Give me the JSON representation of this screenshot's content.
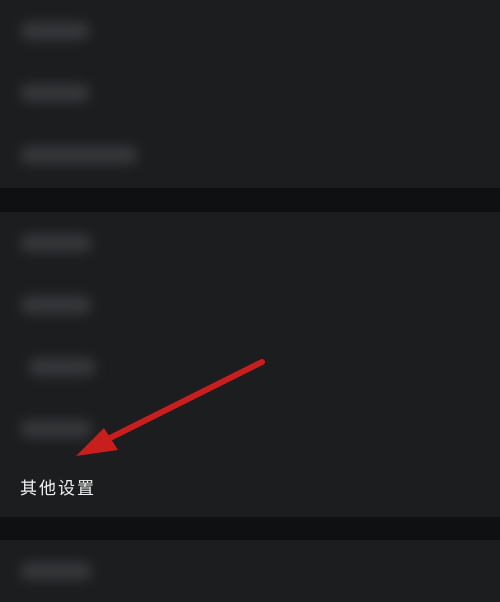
{
  "settings": {
    "other_settings_label": "其他设置"
  },
  "annotation": {
    "arrow_color": "#c81e1e"
  },
  "icons": {
    "pointer": "red-arrow-icon"
  }
}
